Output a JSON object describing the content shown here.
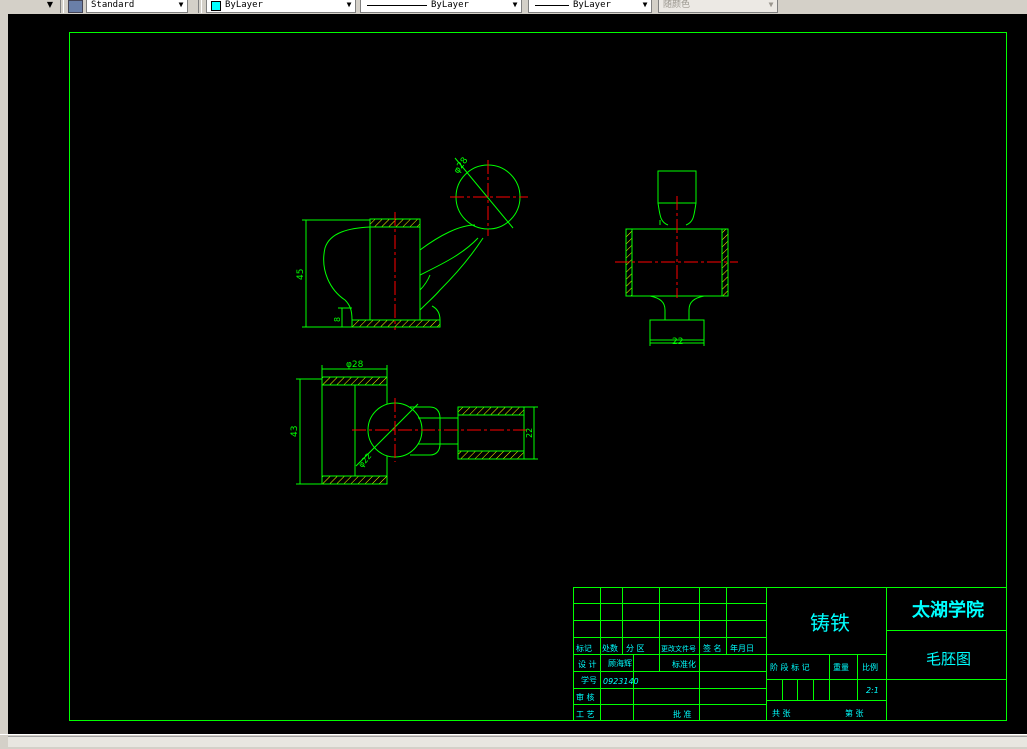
{
  "toolbar": {
    "style_name": "Standard",
    "color": "ByLayer",
    "linetype": "ByLayer",
    "lineweight": "ByLayer",
    "plotstyle": "随颜色",
    "color_swatch": "#00ffff"
  },
  "drawing": {
    "dim_phi28_top": "φ28",
    "dim_45": "45",
    "dim_8": "8",
    "dim_22_right": "22",
    "dim_phi28_plan": "φ28",
    "dim_43": "43",
    "dim_phi22": "φ22",
    "dim_22_plan": "22"
  },
  "title_block": {
    "material": "铸铁",
    "school": "太湖学院",
    "drawing_name": "毛胚图",
    "hdr_mark": "标记",
    "hdr_count": "处数",
    "hdr_zone": "分 区",
    "hdr_doc": "更改文件号",
    "hdr_sign": "签 名",
    "hdr_date": "年月日",
    "lbl_design": "设 计",
    "designer": "顾海辉",
    "lbl_std": "标准化",
    "lbl_stage": "阶 段 标 记",
    "lbl_weight": "重量",
    "lbl_scale": "比例",
    "lbl_id": "学号",
    "student_id": "0923140",
    "scale": "2:1",
    "lbl_review": "审 核",
    "lbl_process": "工 艺",
    "lbl_approve": "批 准",
    "lbl_total": "共 张",
    "lbl_sheet": "第 张"
  },
  "colors": {
    "border": "#00ff00",
    "centerline": "#ff0000",
    "hatch": "#ffff00",
    "title_text": "#00ffff",
    "bg": "#000000"
  }
}
